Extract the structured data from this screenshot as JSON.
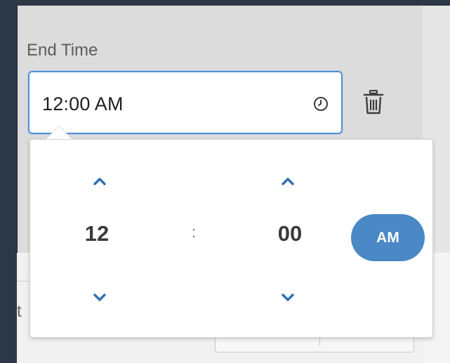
{
  "end_time": {
    "label": "End Time",
    "value": "12:00 AM"
  },
  "time_picker": {
    "hour": "12",
    "separator": ":",
    "minute": "00",
    "period": "AM"
  },
  "background": {
    "partial_label": "t"
  },
  "colors": {
    "accent": "#4a88c6",
    "input_border": "#4a90d9",
    "arrow": "#2f6fb4",
    "page_bg": "#2c3845",
    "panel_bg": "#dcdcdc"
  },
  "icons": {
    "clock": "clock-icon",
    "trash": "trash-icon",
    "up": "chevron-up-icon",
    "down": "chevron-down-icon"
  }
}
